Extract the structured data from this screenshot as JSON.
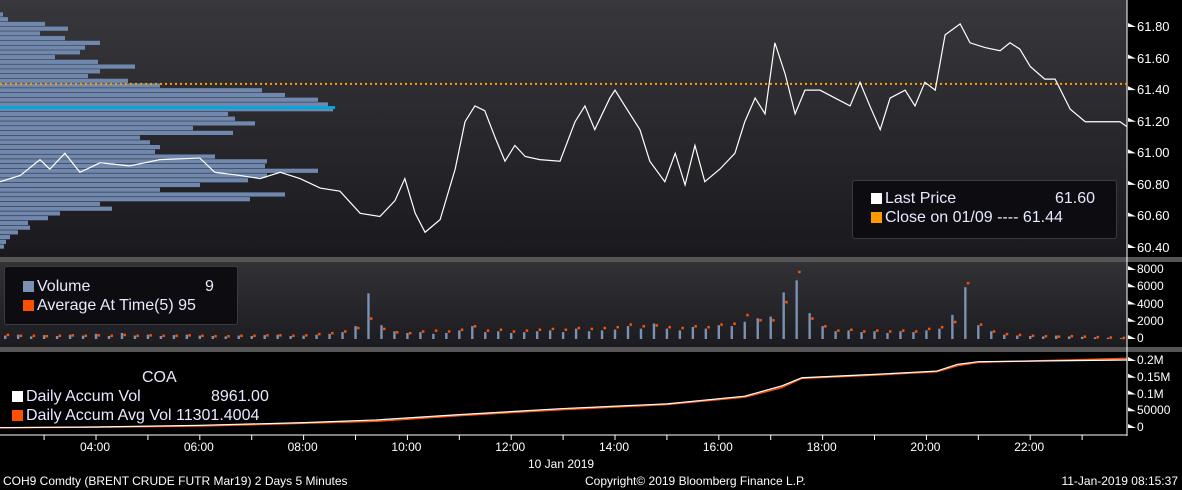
{
  "price_legend": {
    "last_price_label": "Last Price",
    "last_price_value": "61.60",
    "close_label": "Close on 01/09 ----",
    "close_value": "61.44"
  },
  "volume_legend": {
    "volume_label": "Volume",
    "volume_value": "9",
    "avg_label": "Average At Time(5)",
    "avg_value": "95"
  },
  "accum_legend": {
    "title": "COA",
    "vol_label": "Daily Accum Vol",
    "vol_value": "8961.00",
    "avg_label": "Daily Accum Avg Vol",
    "avg_value": "11301.4004"
  },
  "footer": {
    "security": "COH9 Comdty (BRENT CRUDE FUTR  Mar19) 2 Days 5 Minutes",
    "copyright": "Copyright© 2019 Bloomberg Finance L.P.",
    "timestamp": "11-Jan-2019 08:15:37"
  },
  "colors": {
    "price": "#ffffff",
    "close": "#ff9900",
    "volume": "#7a90b4",
    "avg": "#ff5000",
    "profile": "#7088ad",
    "poc": "#00a8e0"
  },
  "chart_data": [
    {
      "type": "line",
      "name": "price",
      "ylabels": [
        "61.80",
        "61.60",
        "61.40",
        "61.20",
        "61.00",
        "60.80",
        "60.60",
        "60.40"
      ],
      "yticks": [
        61.8,
        61.6,
        61.4,
        61.2,
        61.0,
        60.8,
        60.6,
        60.4
      ],
      "close_reference": 61.44,
      "last": 61.6,
      "points": [
        [
          2.15,
          60.82
        ],
        [
          2.54,
          60.86
        ],
        [
          2.92,
          60.96
        ],
        [
          3.11,
          60.9
        ],
        [
          3.4,
          61.0
        ],
        [
          3.69,
          60.88
        ],
        [
          4.08,
          60.94
        ],
        [
          4.65,
          60.92
        ],
        [
          5.23,
          60.96
        ],
        [
          6.0,
          60.97
        ],
        [
          6.29,
          60.88
        ],
        [
          6.77,
          60.86
        ],
        [
          7.16,
          60.84
        ],
        [
          7.55,
          60.88
        ],
        [
          7.93,
          60.84
        ],
        [
          8.32,
          60.78
        ],
        [
          8.7,
          60.76
        ],
        [
          9.09,
          60.62
        ],
        [
          9.47,
          60.6
        ],
        [
          9.76,
          60.7
        ],
        [
          9.95,
          60.84
        ],
        [
          10.15,
          60.62
        ],
        [
          10.34,
          60.5
        ],
        [
          10.63,
          60.58
        ],
        [
          10.92,
          60.9
        ],
        [
          11.11,
          61.2
        ],
        [
          11.3,
          61.3
        ],
        [
          11.49,
          61.27
        ],
        [
          11.69,
          61.1
        ],
        [
          11.88,
          60.95
        ],
        [
          12.07,
          61.05
        ],
        [
          12.27,
          60.98
        ],
        [
          12.55,
          60.96
        ],
        [
          12.94,
          60.95
        ],
        [
          13.23,
          61.2
        ],
        [
          13.42,
          61.3
        ],
        [
          13.61,
          61.15
        ],
        [
          13.9,
          61.35
        ],
        [
          14.0,
          61.4
        ],
        [
          14.19,
          61.3
        ],
        [
          14.48,
          61.15
        ],
        [
          14.67,
          60.95
        ],
        [
          14.96,
          60.82
        ],
        [
          15.16,
          61.0
        ],
        [
          15.35,
          60.8
        ],
        [
          15.54,
          61.05
        ],
        [
          15.73,
          60.82
        ],
        [
          16.02,
          60.9
        ],
        [
          16.31,
          61.0
        ],
        [
          16.5,
          61.2
        ],
        [
          16.7,
          61.35
        ],
        [
          16.89,
          61.25
        ],
        [
          17.08,
          61.7
        ],
        [
          17.28,
          61.5
        ],
        [
          17.47,
          61.25
        ],
        [
          17.66,
          61.4
        ],
        [
          17.95,
          61.4
        ],
        [
          18.24,
          61.35
        ],
        [
          18.53,
          61.3
        ],
        [
          18.72,
          61.45
        ],
        [
          18.91,
          61.3
        ],
        [
          19.11,
          61.15
        ],
        [
          19.3,
          61.35
        ],
        [
          19.59,
          61.4
        ],
        [
          19.78,
          61.3
        ],
        [
          19.97,
          61.45
        ],
        [
          20.17,
          61.4
        ],
        [
          20.36,
          61.75
        ],
        [
          20.65,
          61.82
        ],
        [
          20.84,
          61.7
        ],
        [
          21.13,
          61.67
        ],
        [
          21.42,
          61.65
        ],
        [
          21.61,
          61.7
        ],
        [
          21.8,
          61.66
        ],
        [
          22.0,
          61.55
        ],
        [
          22.28,
          61.47
        ],
        [
          22.48,
          61.47
        ],
        [
          22.77,
          61.28
        ],
        [
          23.06,
          61.2
        ],
        [
          23.35,
          61.2
        ],
        [
          23.73,
          61.2
        ],
        [
          23.86,
          61.17
        ]
      ],
      "profile_levels": [
        61.88,
        61.85,
        61.82,
        61.79,
        61.76,
        61.73,
        61.7,
        61.67,
        61.64,
        61.61,
        61.58,
        61.55,
        61.52,
        61.49,
        61.46,
        61.43,
        61.4,
        61.37,
        61.34,
        61.31,
        61.28,
        61.25,
        61.22,
        61.19,
        61.16,
        61.13,
        61.1,
        61.07,
        61.04,
        61.01,
        60.98,
        60.95,
        60.92,
        60.89,
        60.86,
        60.83,
        60.8,
        60.77,
        60.74,
        60.71,
        60.68,
        60.65,
        60.62,
        60.59,
        60.56,
        60.53,
        60.5,
        60.47,
        60.44,
        60.41
      ],
      "profile_volume": [
        3,
        8,
        45,
        68,
        40,
        65,
        100,
        85,
        80,
        55,
        98,
        135,
        100,
        88,
        128,
        160,
        262,
        285,
        318,
        328,
        333,
        228,
        235,
        255,
        193,
        233,
        140,
        150,
        160,
        155,
        215,
        267,
        265,
        318,
        267,
        248,
        200,
        160,
        285,
        250,
        100,
        112,
        60,
        48,
        28,
        30,
        18,
        10,
        6,
        4
      ],
      "poc_price": 61.29
    },
    {
      "type": "bar",
      "name": "volume",
      "ylabels": [
        "8000",
        "6000",
        "4000",
        "2000",
        "0"
      ],
      "yticks": [
        8000,
        6000,
        4000,
        2000,
        0
      ],
      "start_hour": 2.25,
      "step_hours": 0.25,
      "volume": [
        400,
        500,
        300,
        450,
        350,
        500,
        400,
        600,
        350,
        700,
        400,
        500,
        350,
        450,
        500,
        400,
        350,
        300,
        400,
        350,
        450,
        500,
        350,
        400,
        500,
        600,
        800,
        1500,
        5300,
        1600,
        900,
        700,
        800,
        600,
        700,
        1000,
        1500,
        800,
        900,
        700,
        800,
        900,
        1000,
        800,
        1200,
        900,
        1000,
        1100,
        1500,
        1200,
        1800,
        1200,
        1000,
        1400,
        1200,
        1600,
        1500,
        2000,
        2400,
        2600,
        5400,
        6800,
        3000,
        1500,
        900,
        1000,
        800,
        900,
        700,
        900,
        800,
        1000,
        1200,
        2800,
        6000,
        1600,
        900,
        500,
        400,
        350,
        300,
        400,
        300,
        250,
        200,
        150,
        100
      ],
      "average": [
        500,
        400,
        400,
        350,
        400,
        450,
        400,
        450,
        400,
        500,
        400,
        450,
        400,
        400,
        450,
        400,
        350,
        350,
        400,
        400,
        450,
        450,
        400,
        450,
        600,
        700,
        900,
        1300,
        2400,
        1200,
        800,
        700,
        900,
        1000,
        900,
        1100,
        1500,
        1000,
        1100,
        900,
        1000,
        1100,
        1200,
        1100,
        1300,
        1200,
        1300,
        1400,
        1700,
        1500,
        1600,
        1400,
        1300,
        1500,
        1400,
        1700,
        1800,
        2800,
        2200,
        2200,
        4300,
        7800,
        2400,
        1500,
        1000,
        1100,
        900,
        1000,
        900,
        1000,
        900,
        1200,
        1400,
        2000,
        6500,
        1700,
        900,
        600,
        500,
        400,
        350,
        300,
        350,
        300,
        250,
        200,
        150
      ]
    },
    {
      "type": "line",
      "name": "daily-accum",
      "ylabels": [
        "0.2M",
        "0.15M",
        "0.1M",
        "50000",
        "0"
      ],
      "yticks": [
        200000,
        150000,
        100000,
        50000,
        0
      ],
      "vol": [
        [
          2.15,
          1000
        ],
        [
          4,
          3000
        ],
        [
          6,
          8000
        ],
        [
          8,
          16000
        ],
        [
          9.4,
          24000
        ],
        [
          11,
          40000
        ],
        [
          13,
          58000
        ],
        [
          15,
          72000
        ],
        [
          16.5,
          95000
        ],
        [
          17.2,
          125000
        ],
        [
          17.6,
          150000
        ],
        [
          19,
          160000
        ],
        [
          20.2,
          170000
        ],
        [
          20.6,
          190000
        ],
        [
          21,
          198000
        ],
        [
          23.86,
          203000
        ]
      ],
      "avg": [
        [
          2.15,
          800
        ],
        [
          4,
          2500
        ],
        [
          6,
          6000
        ],
        [
          8,
          14000
        ],
        [
          9.4,
          20000
        ],
        [
          11,
          37000
        ],
        [
          13,
          55000
        ],
        [
          15,
          70000
        ],
        [
          16.5,
          92000
        ],
        [
          17.2,
          120000
        ],
        [
          17.6,
          148000
        ],
        [
          19,
          158000
        ],
        [
          20.2,
          168000
        ],
        [
          20.6,
          186000
        ],
        [
          21,
          196000
        ],
        [
          23.86,
          208000
        ]
      ]
    },
    {
      "type": "axis",
      "name": "time",
      "xlabels": [
        "04:00",
        "06:00",
        "08:00",
        "10:00",
        "12:00",
        "14:00",
        "16:00",
        "18:00",
        "20:00",
        "22:00"
      ],
      "xvalues": [
        4,
        6,
        8,
        10,
        12,
        14,
        16,
        18,
        20,
        22
      ],
      "date_label": "10 Jan 2019"
    }
  ]
}
